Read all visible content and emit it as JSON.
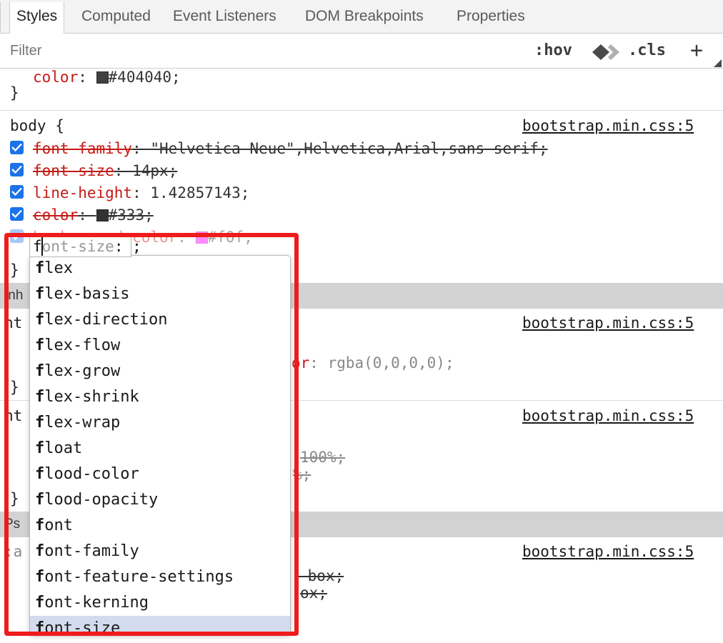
{
  "tabs": [
    {
      "label": "Styles",
      "selected": true
    },
    {
      "label": "Computed",
      "selected": false
    },
    {
      "label": "Event Listeners",
      "selected": false
    },
    {
      "label": "DOM Breakpoints",
      "selected": false
    },
    {
      "label": "Properties",
      "selected": false
    }
  ],
  "toolbar": {
    "filter_placeholder": "Filter",
    "hov_label": ":hov",
    "cls_label": ".cls",
    "plus_label": "+",
    "layers_icon": "layers-icon",
    "resize_grip": "resize-grip-icon"
  },
  "rules": {
    "partial_top": {
      "prop": "color",
      "colon": ":",
      "swatch_color": "#404040",
      "value": "#404040;",
      "close_brace": "}"
    },
    "body_rule": {
      "selector": "body {",
      "origin": "bootstrap.min.css:5",
      "declarations": [
        {
          "prop": "font-family",
          "value": "\"Helvetica Neue\",Helvetica,Arial,sans-serif;",
          "checked": true,
          "overridden": true
        },
        {
          "prop": "font-size",
          "value": "14px;",
          "checked": true,
          "overridden": true
        },
        {
          "prop": "line-height",
          "value": "1.42857143;",
          "checked": true,
          "overridden": false
        },
        {
          "prop": "color",
          "value": "#333;",
          "swatch_color": "#333333",
          "checked": true,
          "overridden": true
        },
        {
          "prop": "background-color",
          "value": "#f0f;",
          "swatch_color": "#ff00ff",
          "checked": true,
          "overridden": false,
          "faded": true
        }
      ],
      "close_brace": "}"
    },
    "hidden_rows": {
      "close_brace_1": "}",
      "inherited_band": "Inh",
      "ht_1": "ht",
      "origin_1": "bootstrap.min.css:5",
      "decl_1_tail": "or: rgba(0,0,0,0);",
      "close_brace_2": "}",
      "ht_2": "ht",
      "origin_2": "bootstrap.min.css:5",
      "decl_2_tail": "100%;",
      "decl_3_tail": "%;",
      "close_brace_3": "}",
      "pseudo_band": "Ps",
      "pseudo_sel": ":a",
      "origin_3": "bootstrap.min.css:5",
      "decl_4_tail": "-box;",
      "decl_5_tail": "ox;"
    }
  },
  "editor": {
    "typed_text": "f",
    "ghost_text": "ont-size",
    "colon": ":",
    "semicolon": ";"
  },
  "autocomplete": {
    "items": [
      {
        "prefix": "f",
        "rest": "lex",
        "selected": false
      },
      {
        "prefix": "f",
        "rest": "lex-basis",
        "selected": false
      },
      {
        "prefix": "f",
        "rest": "lex-direction",
        "selected": false
      },
      {
        "prefix": "f",
        "rest": "lex-flow",
        "selected": false
      },
      {
        "prefix": "f",
        "rest": "lex-grow",
        "selected": false
      },
      {
        "prefix": "f",
        "rest": "lex-shrink",
        "selected": false
      },
      {
        "prefix": "f",
        "rest": "lex-wrap",
        "selected": false
      },
      {
        "prefix": "f",
        "rest": "loat",
        "selected": false
      },
      {
        "prefix": "f",
        "rest": "lood-color",
        "selected": false
      },
      {
        "prefix": "f",
        "rest": "lood-opacity",
        "selected": false
      },
      {
        "prefix": "f",
        "rest": "ont",
        "selected": false
      },
      {
        "prefix": "f",
        "rest": "ont-family",
        "selected": false
      },
      {
        "prefix": "f",
        "rest": "ont-feature-settings",
        "selected": false
      },
      {
        "prefix": "f",
        "rest": "ont-kerning",
        "selected": false
      },
      {
        "prefix": "f",
        "rest": "ont-size",
        "selected": true
      }
    ]
  },
  "annotation": {
    "highlight_color": "#ee1c1c"
  }
}
